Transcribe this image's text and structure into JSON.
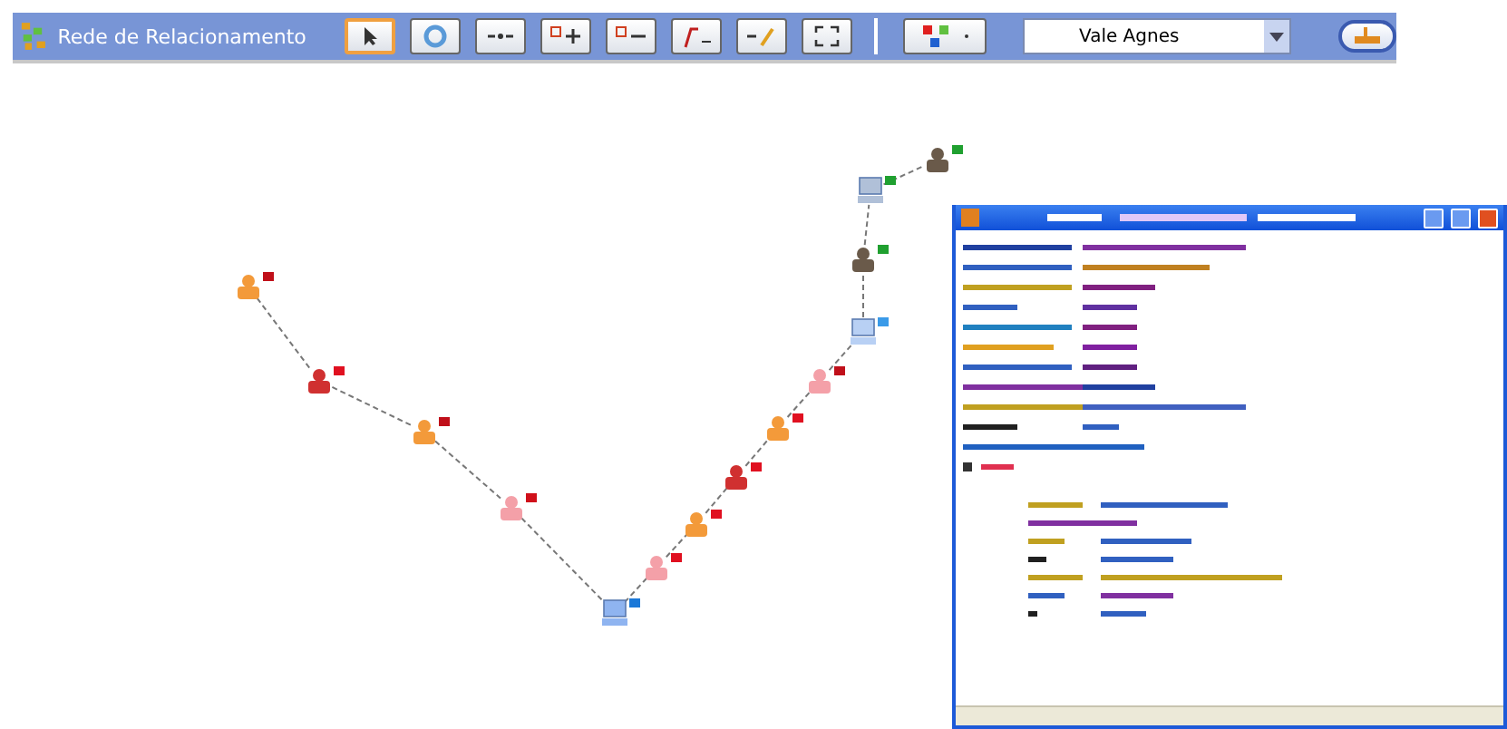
{
  "toolbar": {
    "title": "Rede de Relacionamento",
    "combo_value": "Vale Agnes"
  },
  "nodes": [
    {
      "kind": "person",
      "color": "#c0101a"
    },
    {
      "kind": "suspect",
      "color": "#e01020"
    },
    {
      "kind": "person",
      "color": "#c0101a"
    },
    {
      "kind": "contact",
      "color": "#d0101a"
    },
    {
      "kind": "computer",
      "color": "#1a78d8"
    },
    {
      "kind": "contact",
      "color": "#e01020"
    },
    {
      "kind": "person",
      "color": "#e01020"
    },
    {
      "kind": "suspect",
      "color": "#e01020"
    },
    {
      "kind": "person",
      "color": "#e01020"
    },
    {
      "kind": "contact",
      "color": "#c0101a"
    },
    {
      "kind": "terminal",
      "color": "#3a9ae8"
    },
    {
      "kind": "agent",
      "color": "#20a030"
    },
    {
      "kind": "server",
      "color": "#20a030"
    },
    {
      "kind": "agent",
      "color": "#20a030"
    }
  ]
}
